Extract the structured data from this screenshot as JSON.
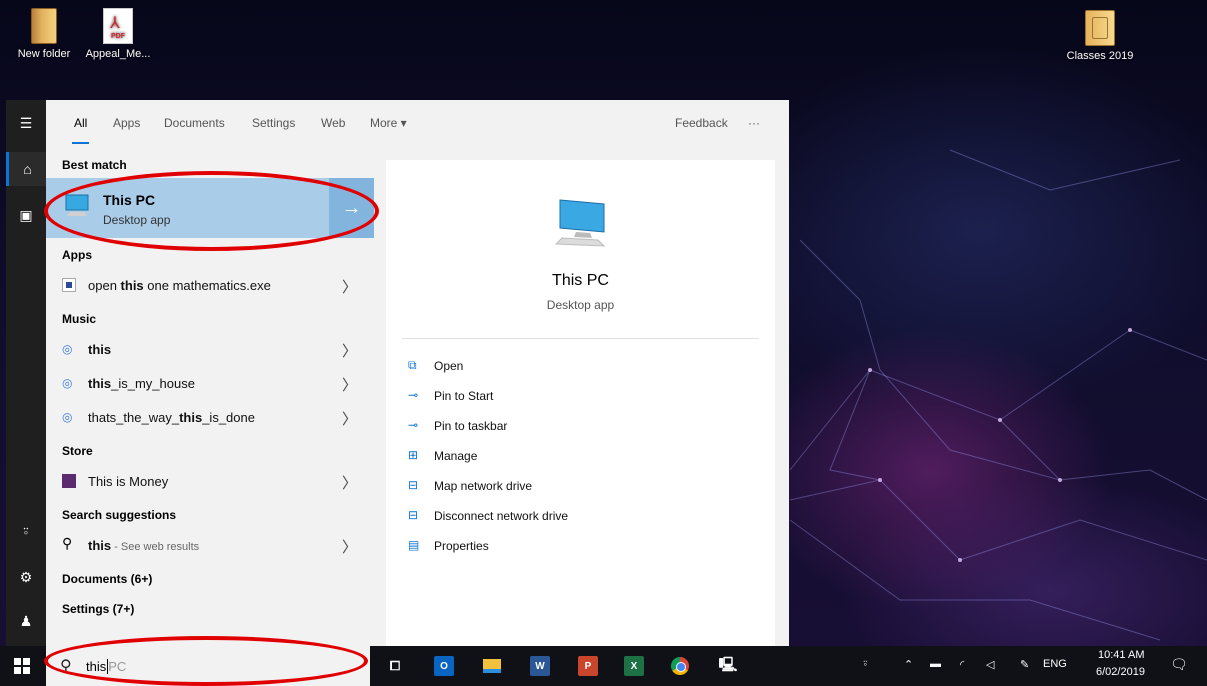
{
  "desktop": {
    "icons": [
      {
        "label": "New folder",
        "icon": "folder-icon"
      },
      {
        "label": "Appeal_Me...",
        "icon": "pdf-file-icon",
        "badge": "PDF"
      },
      {
        "label": "Classes 2019",
        "icon": "zip-folder-icon"
      }
    ]
  },
  "rail": {
    "items": [
      "hamburger-icon",
      "home-icon",
      "documents-icon",
      "add-person-icon",
      "gear-icon",
      "person-icon"
    ]
  },
  "tabs": {
    "all": "All",
    "apps": "Apps",
    "documents": "Documents",
    "settings": "Settings",
    "web": "Web",
    "more": "More ▾",
    "feedback": "Feedback",
    "ellipsis": "···"
  },
  "results": {
    "best_match_header": "Best match",
    "best_match": {
      "title": "This PC",
      "subtitle": "Desktop app",
      "arrow": "→"
    },
    "apps_header": "Apps",
    "apps": [
      {
        "pre": "open ",
        "bold": "this",
        "post": " one mathematics.exe"
      }
    ],
    "music_header": "Music",
    "music": [
      {
        "pre": "",
        "bold": "this",
        "post": ""
      },
      {
        "pre": "",
        "bold": "this",
        "post": "_is_my_house"
      },
      {
        "pre": "thats_the_way_",
        "bold": "this",
        "post": "_is_done"
      }
    ],
    "store_header": "Store",
    "store": [
      {
        "label": "This is Money"
      }
    ],
    "suggestions_header": "Search suggestions",
    "suggestion": {
      "bold": "this",
      "hint": " - See web results"
    },
    "documents_header": "Documents (6+)",
    "settings_header": "Settings (7+)"
  },
  "detail": {
    "title": "This PC",
    "subtitle": "Desktop app",
    "actions": [
      {
        "label": "Open",
        "icon": "open-icon"
      },
      {
        "label": "Pin to Start",
        "icon": "pin-icon"
      },
      {
        "label": "Pin to taskbar",
        "icon": "pin-icon"
      },
      {
        "label": "Manage",
        "icon": "manage-icon"
      },
      {
        "label": "Map network drive",
        "icon": "network-drive-icon"
      },
      {
        "label": "Disconnect network drive",
        "icon": "network-drive-icon"
      },
      {
        "label": "Properties",
        "icon": "properties-icon"
      }
    ]
  },
  "search": {
    "typed": "this",
    "suggestion": "PC"
  },
  "taskbar": {
    "apps": [
      "task-view-icon",
      "outlook-icon",
      "file-explorer-icon",
      "word-icon",
      "powerpoint-icon",
      "excel-icon",
      "chrome-icon",
      "this-pc-icon"
    ],
    "lang": "ENG",
    "time": "10:41 AM",
    "date": "6/02/2019"
  },
  "colors": {
    "accent": "#0a74d9",
    "highlight": "#a9cce9",
    "annotation": "#e00000"
  }
}
